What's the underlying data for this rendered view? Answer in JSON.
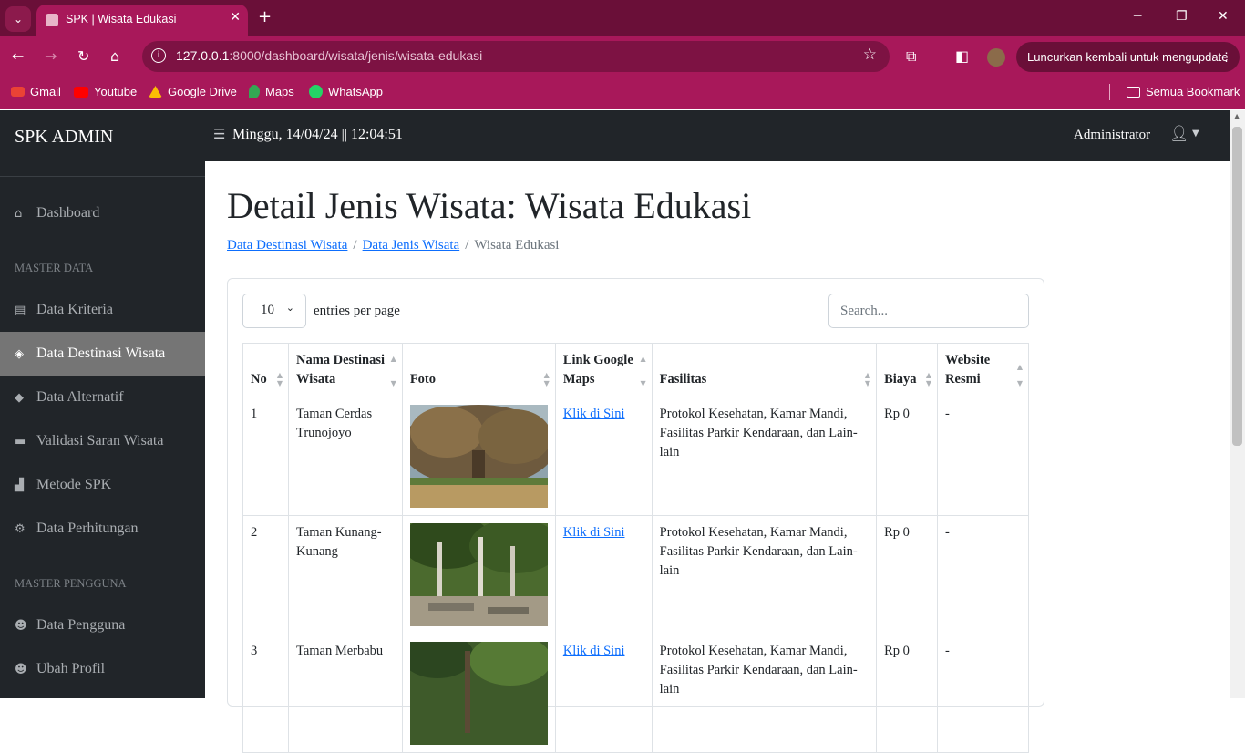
{
  "browser": {
    "tab_title": "SPK | Wisata Edukasi",
    "url_host": "127.0.0.1",
    "url_rest": ":8000/dashboard/wisata/jenis/wisata-edukasi",
    "relaunch_label": "Luncurkan kembali untuk mengupdate",
    "bookmarks": [
      "Gmail",
      "Youtube",
      "Google Drive",
      "Maps",
      "WhatsApp"
    ],
    "all_bookmarks": "Semua Bookmark"
  },
  "sidebar": {
    "brand": "SPK ADMIN",
    "dashboard": "Dashboard",
    "heading_master_data": "MASTER DATA",
    "items": [
      "Data Kriteria",
      "Data Destinasi Wisata",
      "Data Alternatif",
      "Validasi Saran Wisata",
      "Metode SPK",
      "Data Perhitungan"
    ],
    "heading_master_pengguna": "MASTER PENGGUNA",
    "user_items": [
      "Data Pengguna",
      "Ubah Profil"
    ]
  },
  "topnav": {
    "datetime": "Minggu, 14/04/24 || 12:04:51",
    "user": "Administrator"
  },
  "page": {
    "title": "Detail Jenis Wisata: Wisata Edukasi",
    "breadcrumb": [
      "Data Destinasi Wisata",
      "Data Jenis Wisata",
      "Wisata Edukasi"
    ]
  },
  "datatable": {
    "per_page": "10",
    "per_page_label": "entries per page",
    "search_placeholder": "Search...",
    "columns": [
      "No",
      "Nama Destinasi Wisata",
      "Foto",
      "Link Google Maps",
      "Fasilitas",
      "Biaya",
      "Website Resmi"
    ],
    "rows": [
      {
        "no": "1",
        "name": "Taman Cerdas Trunojoyo",
        "link": "Klik di Sini",
        "facilities": "Protokol Kesehatan, Kamar Mandi, Fasilitas Parkir Kendaraan, dan Lain-lain",
        "cost": "Rp 0",
        "website": "-"
      },
      {
        "no": "2",
        "name": "Taman Kunang-Kunang",
        "link": "Klik di Sini",
        "facilities": "Protokol Kesehatan, Kamar Mandi, Fasilitas Parkir Kendaraan, dan Lain-lain",
        "cost": "Rp 0",
        "website": "-"
      },
      {
        "no": "3",
        "name": "Taman Merbabu",
        "link": "Klik di Sini",
        "facilities": "Protokol Kesehatan, Kamar Mandi, Fasilitas Parkir Kendaraan, dan Lain-lain",
        "cost": "Rp 0",
        "website": "-"
      }
    ]
  }
}
